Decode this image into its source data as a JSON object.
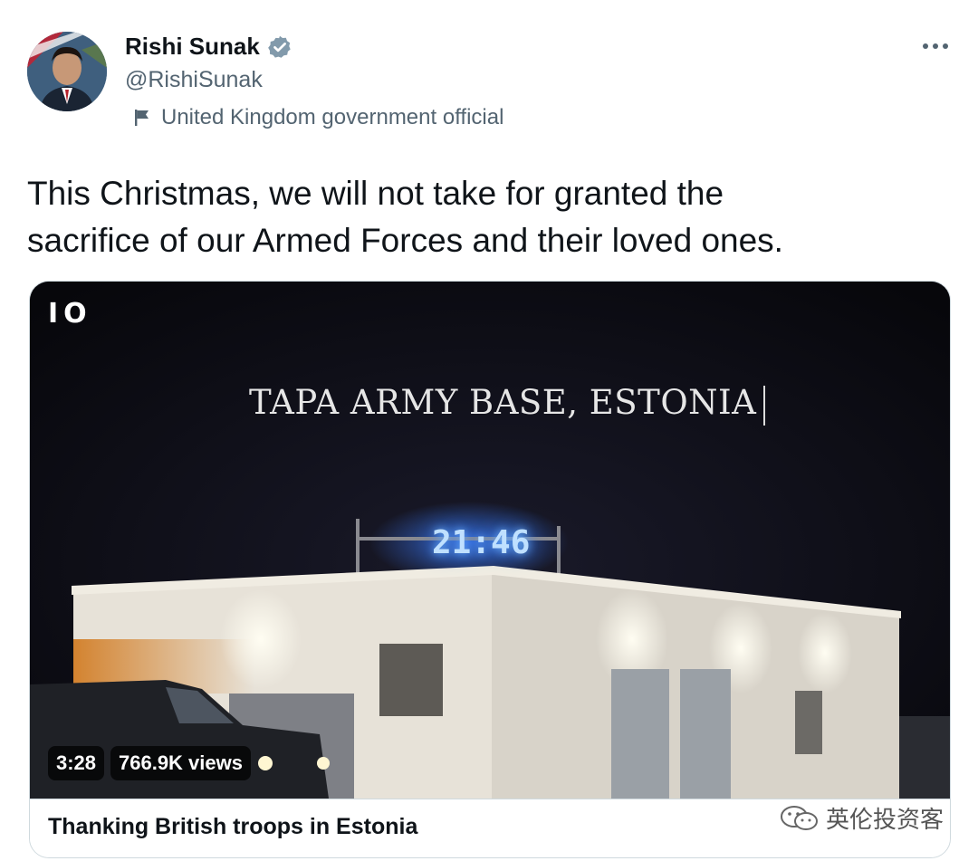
{
  "author": {
    "name": "Rishi Sunak",
    "handle": "@RishiSunak",
    "label": "United Kingdom government official",
    "verified_icon": "verified-badge-icon",
    "label_icon": "flag-icon"
  },
  "tweet": {
    "text_line1": "This Christmas, we will not take for granted the",
    "text_line2": "sacrifice of our Armed Forces and their loved ones."
  },
  "video": {
    "logo": "IO",
    "overlay_title": "TAPA ARMY BASE, ESTONIA",
    "clock": "21:46",
    "duration": "3:28",
    "views": "766.9K views"
  },
  "card": {
    "title": "Thanking British troops in Estonia"
  },
  "watermark": {
    "text": "英伦投资客"
  },
  "colors": {
    "text_primary": "#0f1419",
    "text_secondary": "#536471",
    "verified": "#829aab",
    "border": "#cfd9de"
  }
}
